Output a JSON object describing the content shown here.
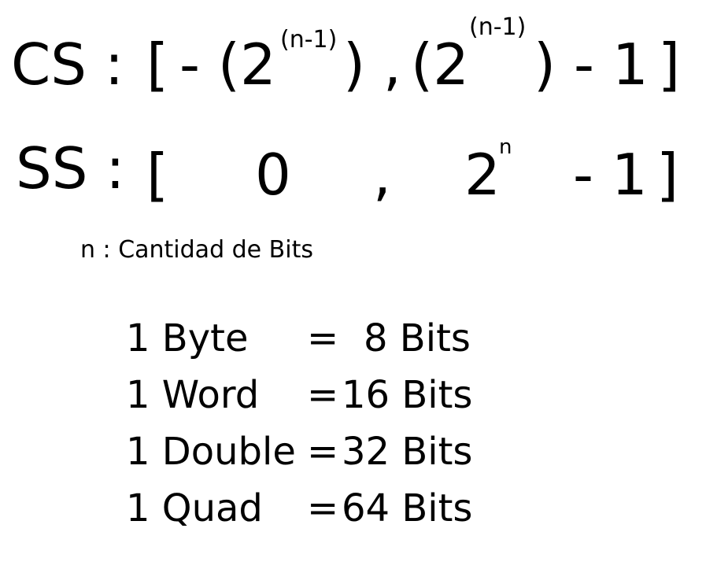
{
  "cs": {
    "label": "CS :",
    "open_bracket": "[",
    "neg_open": "- (2",
    "exp1": "(n-1)",
    "close_comma": ") ,",
    "open2": "(2",
    "exp2": "(n-1)",
    "close_minus_one": ") - 1",
    "close_bracket": "]"
  },
  "ss": {
    "label": "SS :",
    "open_bracket": "[",
    "zero": "0",
    "comma": ",",
    "base": "2",
    "exp": "n",
    "minus_one": "- 1",
    "close_bracket": "]"
  },
  "note": {
    "text": "n : Cantidad de Bits"
  },
  "units": [
    {
      "name": "1 Byte",
      "eq": "=",
      "value": "8 Bits"
    },
    {
      "name": "1 Word",
      "eq": "=",
      "value": "16 Bits"
    },
    {
      "name": "1 Double",
      "eq": "=",
      "value": "32 Bits"
    },
    {
      "name": "1 Quad",
      "eq": "=",
      "value": "64 Bits"
    }
  ]
}
